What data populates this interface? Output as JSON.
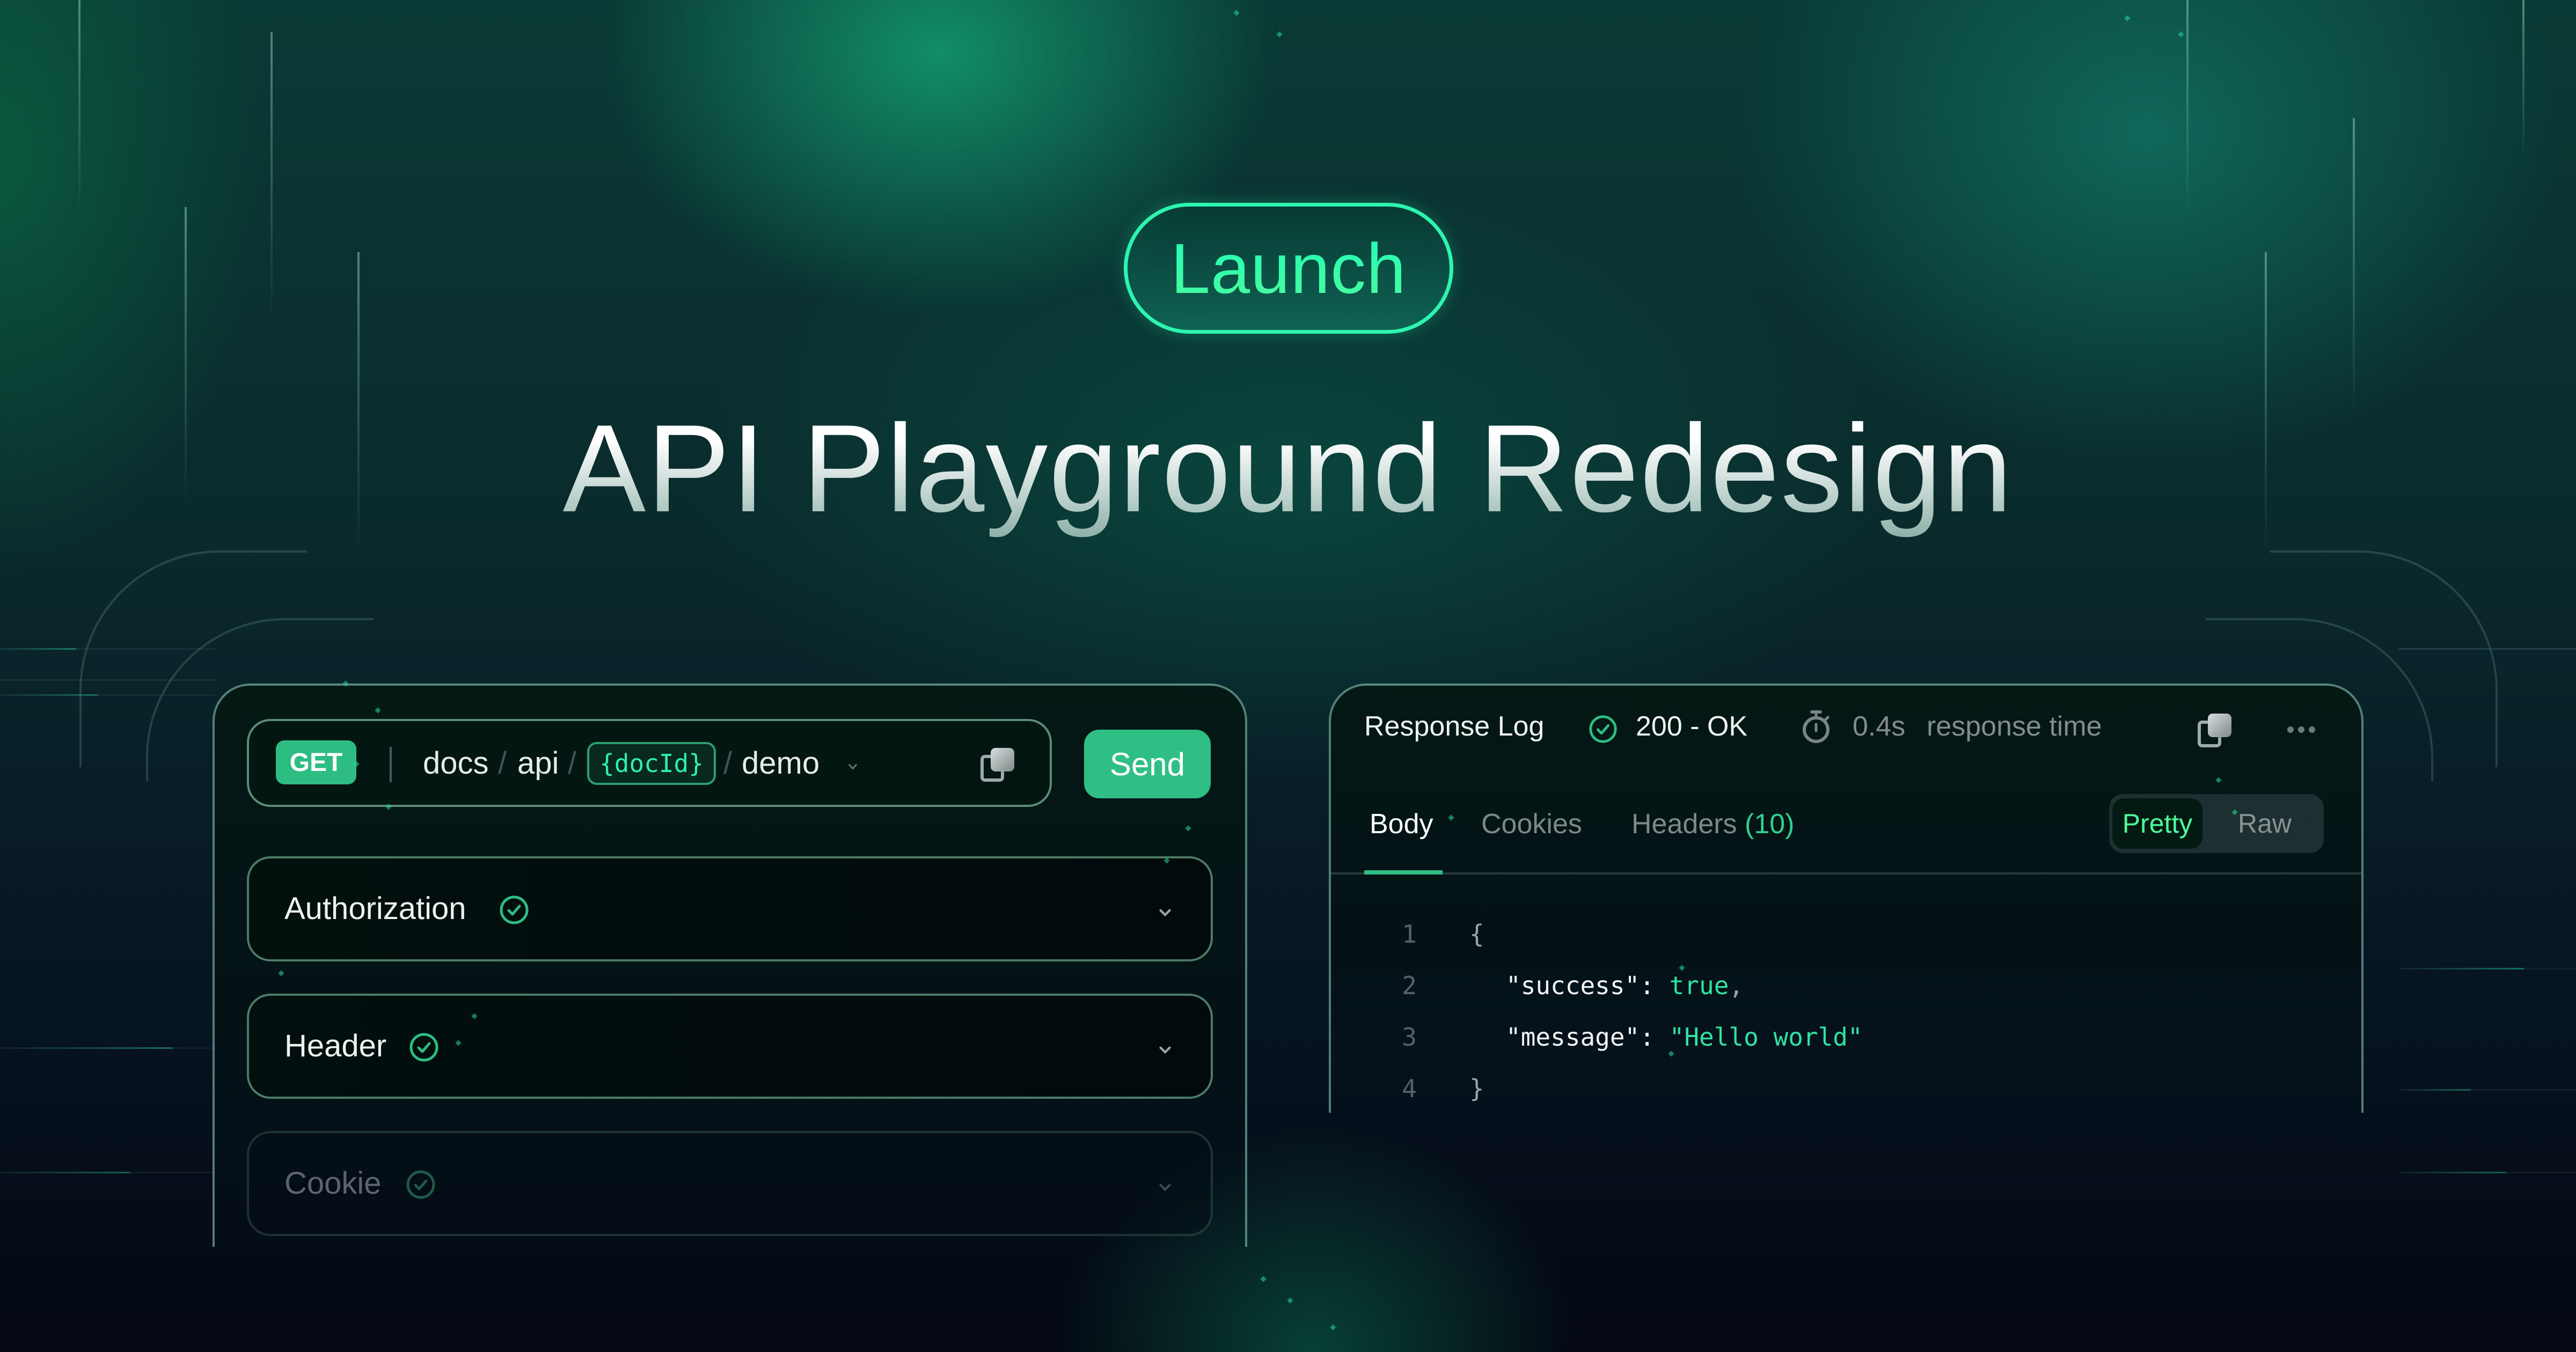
{
  "badge": {
    "label": "Launch"
  },
  "headline": {
    "title": "API Playground Redesign"
  },
  "request": {
    "method": "GET",
    "path_segments": [
      "docs",
      "api",
      "{docId}",
      "demo"
    ],
    "path_param": "{docId}",
    "send_label": "Send",
    "copy_icon": "copy-icon",
    "dropdown_icon": "chevron-down-icon"
  },
  "sections": [
    {
      "label": "Authorization",
      "status_icon": "check-circle-icon",
      "state": "active"
    },
    {
      "label": "Header",
      "status_icon": "check-circle-icon",
      "state": "active"
    },
    {
      "label": "Cookie",
      "status_icon": "check-circle-icon",
      "state": "faded"
    }
  ],
  "response": {
    "title": "Response Log",
    "status": "200 - OK",
    "status_icon": "check-circle-icon",
    "time_value": "0.4s",
    "time_label": "response time",
    "time_icon": "stopwatch-icon",
    "tabs": [
      {
        "label": "Body",
        "active": true
      },
      {
        "label": "Cookies",
        "active": false
      },
      {
        "label": "Headers",
        "count": "(10)",
        "active": false
      }
    ],
    "view_modes": {
      "selected": "Pretty",
      "other": "Raw"
    },
    "code_lines": [
      {
        "n": "1",
        "text": "{"
      },
      {
        "n": "2",
        "key": "\"success\"",
        "value": "true",
        "trail": ","
      },
      {
        "n": "3",
        "key": "\"message\"",
        "value": "\"Hello world\"",
        "trail": ""
      },
      {
        "n": "4",
        "text": "}"
      }
    ]
  },
  "colors": {
    "accent": "#2dbd82",
    "accent_bright": "#2ff5b2",
    "background_dark": "#050a18",
    "background_teal": "#0a3a35"
  }
}
